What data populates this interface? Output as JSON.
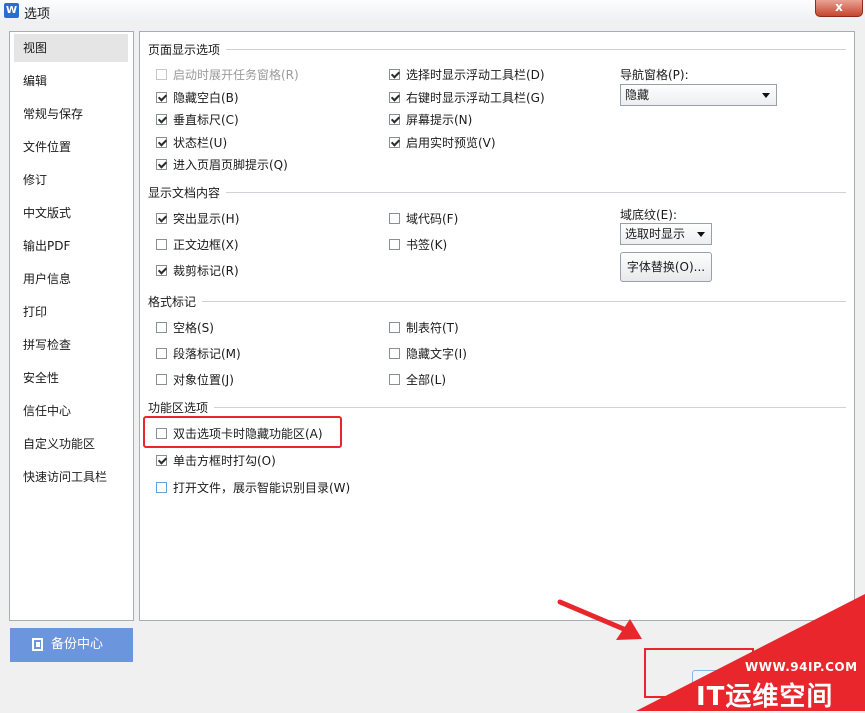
{
  "window": {
    "app_icon_glyph": "W",
    "title": "选项",
    "close_glyph": "x"
  },
  "nav": {
    "items": [
      "视图",
      "编辑",
      "常规与保存",
      "文件位置",
      "修订",
      "中文版式",
      "输出PDF",
      "用户信息",
      "打印",
      "拼写检查",
      "安全性",
      "信任中心",
      "自定义功能区",
      "快速访问工具栏"
    ],
    "selected_index": 0
  },
  "backup_button": "备份中心",
  "page_display": {
    "header": "页面显示选项",
    "col1": [
      {
        "label": "启动时展开任务窗格(R)",
        "checked": false,
        "disabled": true
      },
      {
        "label": "隐藏空白(B)",
        "checked": true
      },
      {
        "label": "垂直标尺(C)",
        "checked": true
      },
      {
        "label": "状态栏(U)",
        "checked": true
      },
      {
        "label": "进入页眉页脚提示(Q)",
        "checked": true
      }
    ],
    "col2": [
      {
        "label": "选择时显示浮动工具栏(D)",
        "checked": true
      },
      {
        "label": "右键时显示浮动工具栏(G)",
        "checked": true
      },
      {
        "label": "屏幕提示(N)",
        "checked": true
      },
      {
        "label": "启用实时预览(V)",
        "checked": true
      }
    ],
    "nav_pane_label": "导航窗格(P):",
    "nav_pane_value": "隐藏"
  },
  "doc_content": {
    "header": "显示文档内容",
    "col1": [
      {
        "label": "突出显示(H)",
        "checked": true
      },
      {
        "label": "正文边框(X)",
        "checked": false
      },
      {
        "label": "裁剪标记(R)",
        "checked": true
      }
    ],
    "col2": [
      {
        "label": "域代码(F)",
        "checked": false
      },
      {
        "label": "书签(K)",
        "checked": false
      }
    ],
    "field_shading_label": "域底纹(E):",
    "field_shading_value": "选取时显示",
    "font_replace_button": "字体替换(O)..."
  },
  "format_marks": {
    "header": "格式标记",
    "col1": [
      {
        "label": "空格(S)",
        "checked": false
      },
      {
        "label": "段落标记(M)",
        "checked": false
      },
      {
        "label": "对象位置(J)",
        "checked": false
      }
    ],
    "col2": [
      {
        "label": "制表符(T)",
        "checked": false
      },
      {
        "label": "隐藏文字(I)",
        "checked": false
      },
      {
        "label": "全部(L)",
        "checked": false
      }
    ]
  },
  "ribbon": {
    "header": "功能区选项",
    "items": [
      {
        "label": "双击选项卡时隐藏功能区(A)",
        "checked": false
      },
      {
        "label": "单击方框时打勾(O)",
        "checked": true
      },
      {
        "label": "打开文件，展示智能识别目录(W)",
        "checked": false
      }
    ]
  },
  "watermark": {
    "url": "WWW.94IP.COM",
    "name": "IT运维空间"
  },
  "colors": {
    "accent": "#6b95dd",
    "highlight": "#e8262c"
  }
}
